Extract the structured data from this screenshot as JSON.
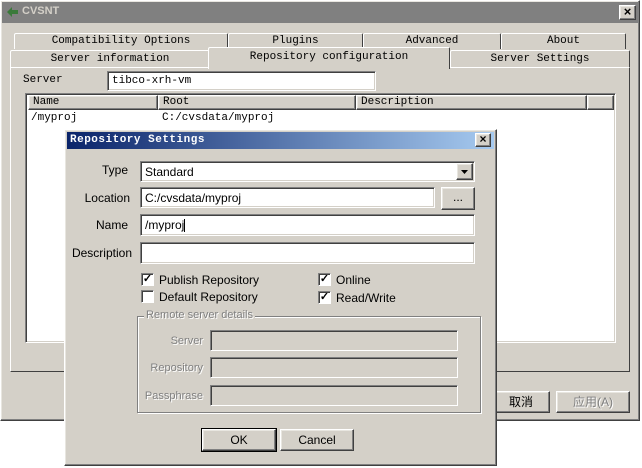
{
  "main_window": {
    "title": "CVSNT",
    "close_glyph": "×",
    "tabs_row1": [
      "Compatibility Options",
      "Plugins",
      "Advanced",
      "About"
    ],
    "tabs_row2": [
      "Server information",
      "Repository configuration",
      "Server Settings"
    ],
    "server_label": "Server",
    "server_value": "tibco-xrh-vm",
    "list_columns": [
      "Name",
      "Root",
      "Description"
    ],
    "list_rows": [
      {
        "name": "/myproj",
        "root": "C:/cvsdata/myproj",
        "description": ""
      }
    ],
    "cancel_label": "取消",
    "apply_label": "应用(A)"
  },
  "dialog": {
    "title": "Repository Settings",
    "close_glyph": "×",
    "type_label": "Type",
    "type_value": "Standard",
    "location_label": "Location",
    "location_value": "C:/cvsdata/myproj",
    "browse_label": "...",
    "name_label": "Name",
    "name_value": "/myproj",
    "description_label": "Description",
    "description_value": "",
    "publish_label": "Publish Repository",
    "publish_checked": true,
    "default_label": "Default Repository",
    "default_checked": false,
    "online_label": "Online",
    "online_checked": true,
    "readwrite_label": "Read/Write",
    "readwrite_checked": true,
    "remote_group_label": "Remote server details",
    "remote_server_label": "Server",
    "remote_repository_label": "Repository",
    "remote_passphrase_label": "Passphrase",
    "ok_label": "OK",
    "cancel_label": "Cancel"
  },
  "colors": {
    "face": "#d4d0c8",
    "title_active_start": "#0a246a",
    "title_active_end": "#a6caf0",
    "title_inactive": "#808080"
  }
}
